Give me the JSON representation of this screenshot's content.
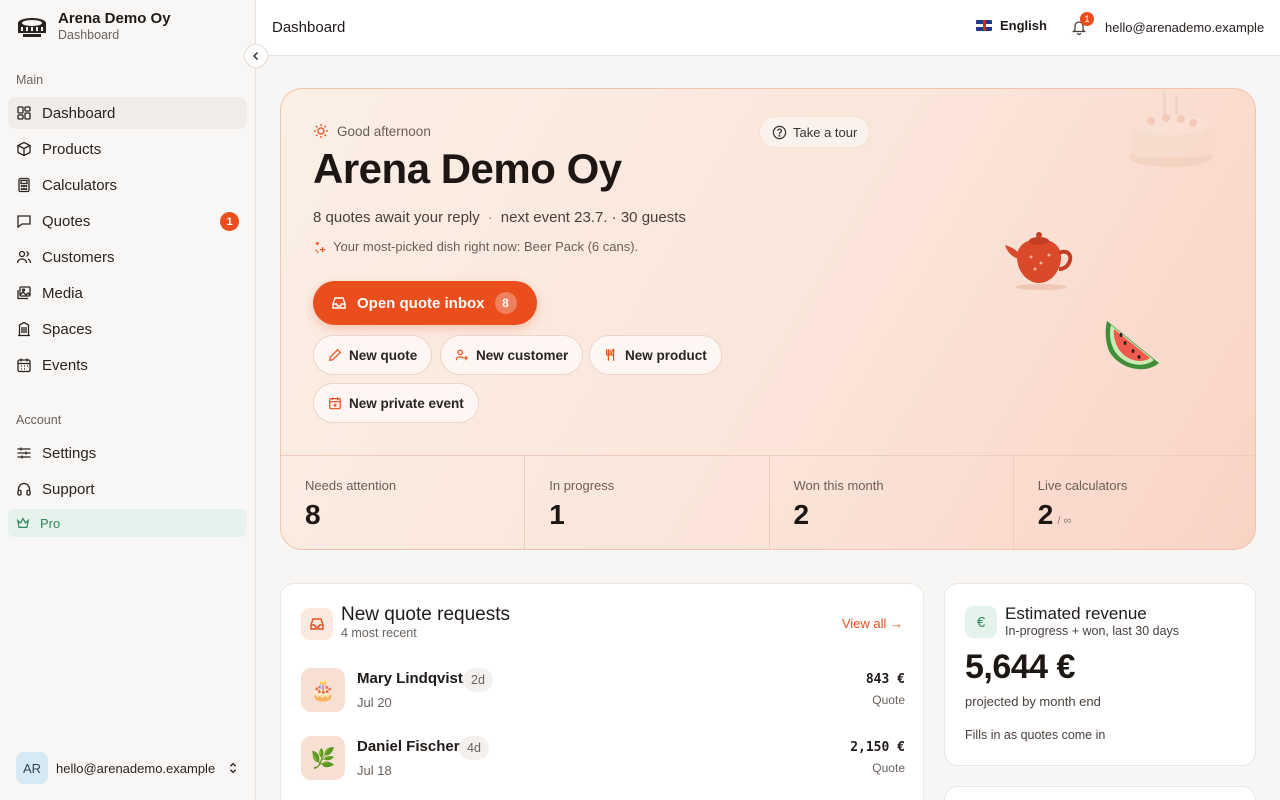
{
  "sidebar": {
    "brand_name": "Arena Demo Oy",
    "brand_sub": "Dashboard",
    "main_section": "Main",
    "items": [
      {
        "label": "Dashboard",
        "icon": "grid-icon"
      },
      {
        "label": "Products",
        "icon": "box-icon"
      },
      {
        "label": "Calculators",
        "icon": "calculator-icon"
      },
      {
        "label": "Quotes",
        "icon": "chat-icon",
        "badge": "1"
      },
      {
        "label": "Customers",
        "icon": "users-icon"
      },
      {
        "label": "Media",
        "icon": "images-icon"
      },
      {
        "label": "Spaces",
        "icon": "building-icon"
      },
      {
        "label": "Events",
        "icon": "calendar-icon"
      }
    ],
    "account_section": "Account",
    "account_items": [
      {
        "label": "Settings",
        "icon": "sliders-icon"
      },
      {
        "label": "Support",
        "icon": "headphones-icon"
      }
    ],
    "pro_label": "Pro",
    "user_initials": "AR",
    "user_email": "hello@arenademo.example"
  },
  "topbar": {
    "title": "Dashboard",
    "language": "English",
    "notification_count": "1",
    "email": "hello@arenademo.example"
  },
  "hero": {
    "greeting": "Good afternoon",
    "title": "Arena Demo Oy",
    "quotes_waiting": "8 quotes await your reply",
    "separator": "·",
    "next_event": "next event 23.7. · 30 guests",
    "note": "Your most-picked dish right now: Beer Pack (6 cans).",
    "tour_label": "Take a tour",
    "primary_label": "Open quote inbox",
    "primary_count": "8",
    "actions": [
      "New quote",
      "New customer",
      "New product",
      "New private event"
    ],
    "stats": [
      {
        "label": "Needs attention",
        "value": "8"
      },
      {
        "label": "In progress",
        "value": "1"
      },
      {
        "label": "Won this month",
        "value": "2"
      },
      {
        "label": "Live calculators",
        "value": "2",
        "suffix": "/ ∞"
      }
    ]
  },
  "requests": {
    "title": "New quote requests",
    "subtitle": "4 most recent",
    "view_all": "View all →",
    "rows": [
      {
        "name": "Mary Lindqvist",
        "age": "2d",
        "date": "Jul 20",
        "amount": "843 €",
        "type": "Quote",
        "emoji": "🎂"
      },
      {
        "name": "Daniel Fischer",
        "age": "4d",
        "date": "Jul 18",
        "amount": "2,150 €",
        "type": "Quote",
        "emoji": "🌿"
      }
    ]
  },
  "revenue": {
    "title": "Estimated revenue",
    "subtitle": "In-progress + won, last 30 days",
    "icon_symbol": "€",
    "value": "5,644 €",
    "projection": "projected by month end",
    "fill_note": "Fills in as quotes come in"
  },
  "colors": {
    "accent": "#ea4e1c",
    "pro_green": "#2e8b5f",
    "hero_bg": "#fbe5da"
  }
}
